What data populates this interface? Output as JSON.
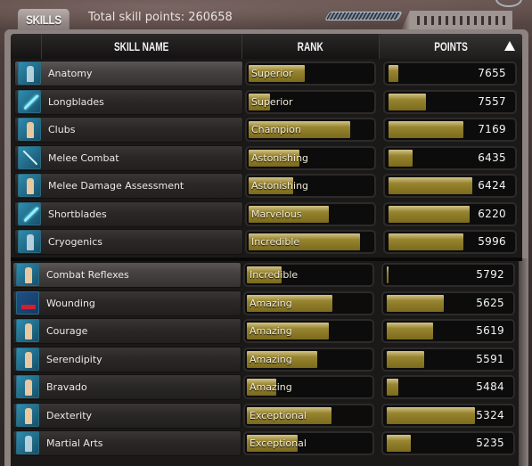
{
  "header": {
    "tab_label": "SKILLS",
    "total_label": "Total skill points: 260658"
  },
  "columns": {
    "name": "SKILL NAME",
    "rank": "RANK",
    "points": "POINTS",
    "sort_indicator": "sort-ascending-icon"
  },
  "colors": {
    "bar_gold": "#988530",
    "panel_bg": "#1b1818",
    "icon_blue": "#2e8db0"
  },
  "skills": [
    {
      "name": "Anatomy",
      "rank": "Superior",
      "rank_progress": 0.45,
      "points": "7655",
      "points_progress": 0.08,
      "icon": "anatomy-icon"
    },
    {
      "name": "Longblades",
      "rank": "Superior",
      "rank_progress": 0.17,
      "points": "7557",
      "points_progress": 0.3,
      "icon": "longblade-icon"
    },
    {
      "name": "Clubs",
      "rank": "Champion",
      "rank_progress": 0.82,
      "points": "7169",
      "points_progress": 0.6,
      "icon": "club-icon"
    },
    {
      "name": "Melee Combat",
      "rank": "Astonishing",
      "rank_progress": 0.41,
      "points": "6435",
      "points_progress": 0.19,
      "icon": "melee-combat-icon"
    },
    {
      "name": "Melee Damage Assessment",
      "rank": "Astonishing",
      "rank_progress": 0.36,
      "points": "6424",
      "points_progress": 0.67,
      "icon": "damage-assessment-icon"
    },
    {
      "name": "Shortblades",
      "rank": "Marvelous",
      "rank_progress": 0.65,
      "points": "6220",
      "points_progress": 0.65,
      "icon": "shortblade-icon"
    },
    {
      "name": "Cryogenics",
      "rank": "Incredible",
      "rank_progress": 0.9,
      "points": "5996",
      "points_progress": 0.6,
      "icon": "cryogenics-icon"
    },
    {
      "name": "Combat Reflexes",
      "rank": "Incredible",
      "rank_progress": 0.28,
      "points": "5792",
      "points_progress": 0.01,
      "icon": "combat-reflexes-icon"
    },
    {
      "name": "Wounding",
      "rank": "Amazing",
      "rank_progress": 0.69,
      "points": "5625",
      "points_progress": 0.46,
      "icon": "wounding-icon"
    },
    {
      "name": "Courage",
      "rank": "Amazing",
      "rank_progress": 0.66,
      "points": "5619",
      "points_progress": 0.37,
      "icon": "courage-icon"
    },
    {
      "name": "Serendipity",
      "rank": "Amazing",
      "rank_progress": 0.57,
      "points": "5591",
      "points_progress": 0.3,
      "icon": "serendipity-icon"
    },
    {
      "name": "Bravado",
      "rank": "Amazing",
      "rank_progress": 0.24,
      "points": "5484",
      "points_progress": 0.09,
      "icon": "bravado-icon"
    },
    {
      "name": "Dexterity",
      "rank": "Exceptional",
      "rank_progress": 0.68,
      "points": "5324",
      "points_progress": 0.71,
      "icon": "dexterity-icon"
    },
    {
      "name": "Martial Arts",
      "rank": "Exceptional",
      "rank_progress": 0.41,
      "points": "5235",
      "points_progress": 0.19,
      "icon": "martial-arts-icon"
    }
  ]
}
